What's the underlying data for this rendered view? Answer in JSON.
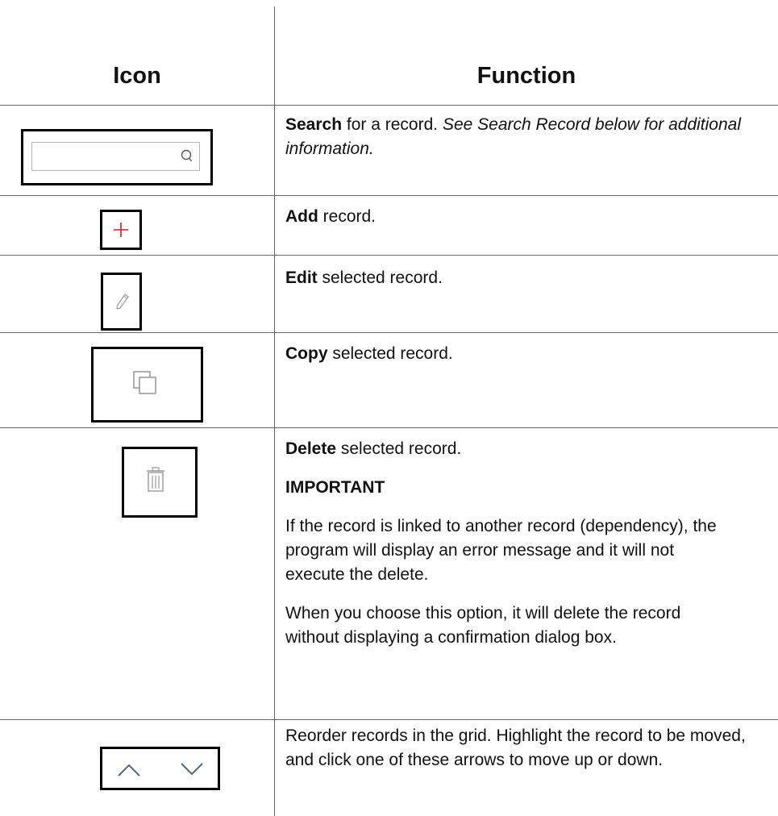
{
  "header": {
    "icon_col": "Icon",
    "function_col": "Function"
  },
  "rows": [
    {
      "icon": "search-icon",
      "bold": "Search",
      "text": " for a record.  ",
      "italic": "See Search Record below for additional information."
    },
    {
      "icon": "plus-icon",
      "bold": "Add",
      "text": " record."
    },
    {
      "icon": "pencil-icon",
      "bold": "Edit",
      "text": " selected record."
    },
    {
      "icon": "copy-icon",
      "bold": "Copy",
      "text": " selected record."
    },
    {
      "icon": "trash-icon",
      "bold": "Delete",
      "text": " selected record.",
      "important_label": "IMPORTANT",
      "para1": "If the record is linked to another record (dependency), the program will display an error message and it will not execute the delete.",
      "para2": "When you choose this option, it will delete the record without displaying a confirmation dialog box."
    },
    {
      "icon": "up-down-arrows-icon",
      "text": "Reorder records in the grid. Highlight the record to be moved, and click one of these arrows to move up or down."
    }
  ],
  "colors": {
    "plus": "#c0202a",
    "icon_gray": "#9a9a9a",
    "border": "#000000",
    "rule": "#666666"
  }
}
